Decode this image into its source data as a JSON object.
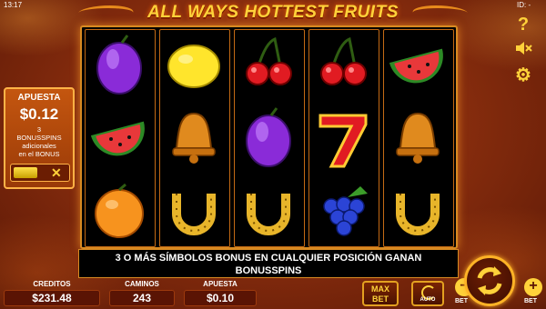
{
  "status": {
    "clock": "13:17",
    "id_label": "ID: -"
  },
  "title": "ALL WAYS HOTTEST FRUITS",
  "bet_panel": {
    "title": "APUESTA",
    "value": "$0.12",
    "line1": "3",
    "line2": "BONUSSPINS",
    "line3": "adicionales",
    "line4": "en el BONUS",
    "close_glyph": "✕"
  },
  "reels": [
    [
      "plum",
      "watermelon",
      "orange"
    ],
    [
      "lemon",
      "bell",
      "horseshoe"
    ],
    [
      "cherries",
      "plum",
      "horseshoe"
    ],
    [
      "cherries",
      "seven",
      "grapes"
    ],
    [
      "watermelon",
      "bell",
      "horseshoe"
    ]
  ],
  "right_icons": {
    "help": "?",
    "settings": "⚙"
  },
  "banner": {
    "line1": "3 O MÁS SÍMBOLOS BONUS EN CUALQUIER POSICIÓN GANAN",
    "line2": "BONUSSPINS"
  },
  "stats": {
    "credits_label": "CREDITOS",
    "credits_value": "$231.48",
    "ways_label": "CAMINOS",
    "ways_value": "243",
    "bet_label": "APUESTA",
    "bet_value": "$0.10"
  },
  "controls": {
    "max_bet_line1": "MAX",
    "max_bet_line2": "BET",
    "auto_label": "AUTO",
    "minus_label": "BET",
    "plus_label": "BET",
    "minus_glyph": "−",
    "plus_glyph": "+"
  },
  "colors": {
    "accent": "#ffd23a",
    "panel": "#c4560f",
    "frame": "#d88a22"
  }
}
